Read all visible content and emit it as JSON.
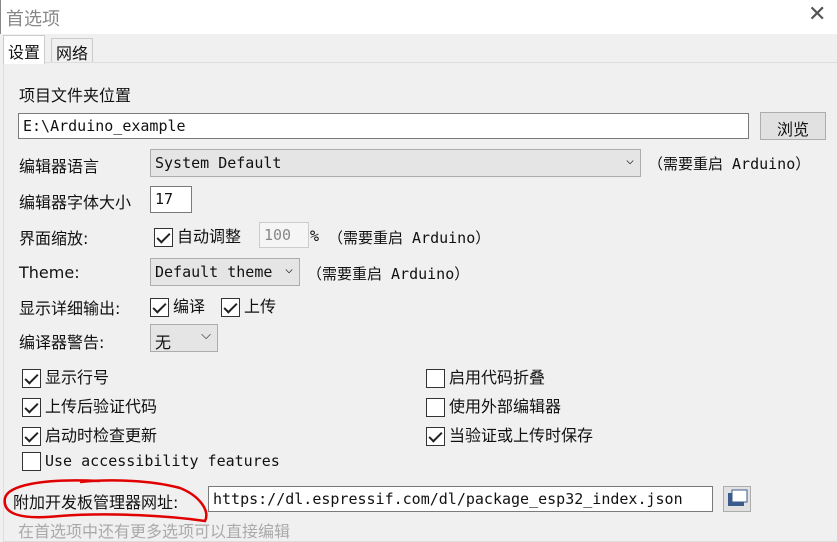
{
  "window": {
    "title": "首选项",
    "close": "✕"
  },
  "tabs": [
    {
      "label": "设置",
      "active": true
    },
    {
      "label": "网络",
      "active": false
    }
  ],
  "sketchbook": {
    "label": "项目文件夹位置",
    "value": "E:\\Arduino_example",
    "browse": "浏览"
  },
  "language": {
    "label": "编辑器语言",
    "value": "System Default",
    "note": "（需要重启 Arduino）"
  },
  "font_size": {
    "label": "编辑器字体大小",
    "value": "17"
  },
  "scale": {
    "label": "界面缩放:",
    "auto_label": "自动调整",
    "auto_checked": true,
    "value": "100",
    "unit": "%",
    "note": "（需要重启 Arduino）"
  },
  "theme": {
    "label": "Theme:",
    "value": "Default theme",
    "note": "（需要重启 Arduino）"
  },
  "verbose": {
    "label": "显示详细输出:",
    "compile": "编译",
    "compile_checked": true,
    "upload": "上传",
    "upload_checked": true
  },
  "warnings": {
    "label": "编译器警告:",
    "value": "无"
  },
  "options": [
    {
      "label": "显示行号",
      "checked": true
    },
    {
      "label": "启用代码折叠",
      "checked": false
    },
    {
      "label": "上传后验证代码",
      "checked": true
    },
    {
      "label": "使用外部编辑器",
      "checked": false
    },
    {
      "label": "启动时检查更新",
      "checked": true
    },
    {
      "label": "当验证或上传时保存",
      "checked": true
    },
    {
      "label": "Use accessibility features",
      "checked": false
    }
  ],
  "boards_url": {
    "label": "附加开发板管理器网址",
    "colon": ":",
    "value": "https://dl.espressif.com/dl/package_esp32_index.json"
  },
  "footer_note": "在首选项中还有更多选项可以直接编辑",
  "colors": {
    "annotation": "#e00000"
  }
}
